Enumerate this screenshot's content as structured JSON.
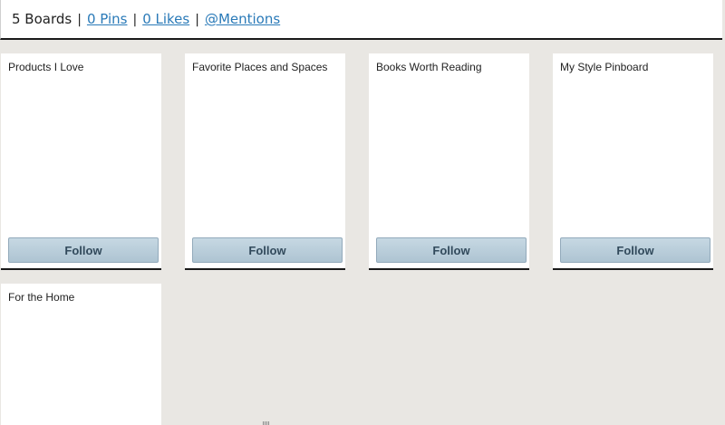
{
  "header": {
    "boards_label": "5 Boards",
    "pins_label": "0 Pins",
    "likes_label": "0 Likes",
    "mentions_label": "@Mentions",
    "separator": "|"
  },
  "boards": [
    {
      "title": "Products I Love",
      "follow_label": "Follow"
    },
    {
      "title": "Favorite Places and Spaces",
      "follow_label": "Follow"
    },
    {
      "title": "Books Worth Reading",
      "follow_label": "Follow"
    },
    {
      "title": "My Style Pinboard",
      "follow_label": "Follow"
    },
    {
      "title": "For the Home"
    }
  ]
}
